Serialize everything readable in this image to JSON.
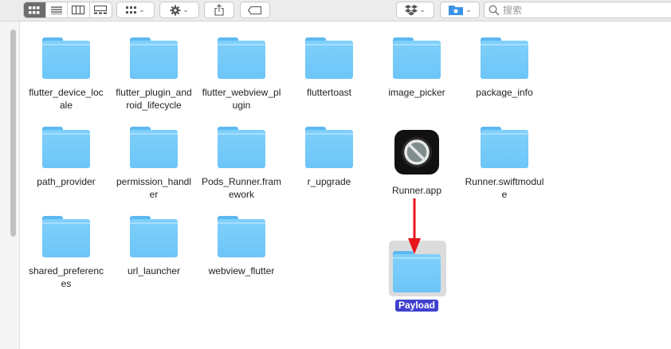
{
  "toolbar": {
    "view_buttons": [
      {
        "name": "icon-view",
        "icon": "icon-grid-icon",
        "selected": true
      },
      {
        "name": "list-view",
        "icon": "list-icon",
        "selected": false
      },
      {
        "name": "column-view",
        "icon": "columns-icon",
        "selected": false
      },
      {
        "name": "gallery-view",
        "icon": "gallery-icon",
        "selected": false
      }
    ],
    "group_icon": "group-grid-icon",
    "action_icon": "gear-icon",
    "share_icon": "share-icon",
    "tag_icon": "tag-icon",
    "dropbox_icon": "dropbox-icon",
    "location_icon": "folder-path-icon",
    "chevron": "⌄"
  },
  "search": {
    "placeholder": "搜索"
  },
  "files": [
    {
      "name": "flutter_device_locale",
      "lines": [
        "flutter_device_loc",
        "ale"
      ],
      "type": "folder"
    },
    {
      "name": "flutter_plugin_android_lifecycle",
      "lines": [
        "flutter_plugin_and",
        "roid_lifecycle"
      ],
      "type": "folder"
    },
    {
      "name": "flutter_webview_plugin",
      "lines": [
        "flutter_webview_pl",
        "ugin"
      ],
      "type": "folder"
    },
    {
      "name": "fluttertoast",
      "lines": [
        "fluttertoast",
        ""
      ],
      "type": "folder"
    },
    {
      "name": "image_picker",
      "lines": [
        "image_picker",
        ""
      ],
      "type": "folder"
    },
    {
      "name": "package_info",
      "lines": [
        "package_info",
        ""
      ],
      "type": "folder"
    },
    {
      "name": "path_provider",
      "lines": [
        "path_provider",
        ""
      ],
      "type": "folder"
    },
    {
      "name": "permission_handler",
      "lines": [
        "permission_handl",
        "er"
      ],
      "type": "folder"
    },
    {
      "name": "Pods_Runner.framework",
      "lines": [
        "Pods_Runner.fram",
        "ework"
      ],
      "type": "folder"
    },
    {
      "name": "r_upgrade",
      "lines": [
        "r_upgrade",
        ""
      ],
      "type": "folder"
    },
    {
      "name": "Runner.app",
      "lines": [
        "Runner.app",
        ""
      ],
      "type": "app"
    },
    {
      "name": "Runner.swiftmodule",
      "lines": [
        "Runner.swiftmodul",
        "e"
      ],
      "type": "folder"
    },
    {
      "name": "shared_preferences",
      "lines": [
        "shared_preferenc",
        "es"
      ],
      "type": "folder"
    },
    {
      "name": "url_launcher",
      "lines": [
        "url_launcher",
        ""
      ],
      "type": "folder"
    },
    {
      "name": "webview_flutter",
      "lines": [
        "webview_flutter",
        ""
      ],
      "type": "folder"
    }
  ],
  "selected_folder": {
    "name": "Payload",
    "selected": true
  },
  "annotation": {
    "type": "arrow",
    "color": "#e8151b"
  },
  "colors": {
    "folder": "#6cc5f8",
    "selection_label": "#3f3fcf",
    "arrow": "#e8151b"
  }
}
